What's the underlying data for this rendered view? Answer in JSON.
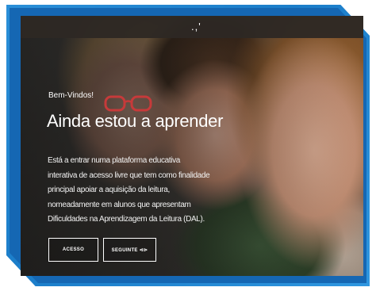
{
  "topbar": {
    "mark": ".,'"
  },
  "hero": {
    "welcome": "Bem-Vindos!",
    "title": "Ainda estou a aprender",
    "description": "Está a entrar numa plataforma educativa interativa de acesso livre que tem como finalidade principal apoiar a aquisição da leitura, nomeadamente em alunos que apresentam Dificuldades na Aprendizagem da Leitura (DAL).",
    "buttons": [
      {
        "label": "ACESSO"
      },
      {
        "label": "SEGUINTE ⊲⊳"
      }
    ]
  },
  "colors": {
    "frame": "#1b7dc9",
    "frame_dark": "#1567b3",
    "text": "#ffffff",
    "topbar": "#2d2824"
  }
}
